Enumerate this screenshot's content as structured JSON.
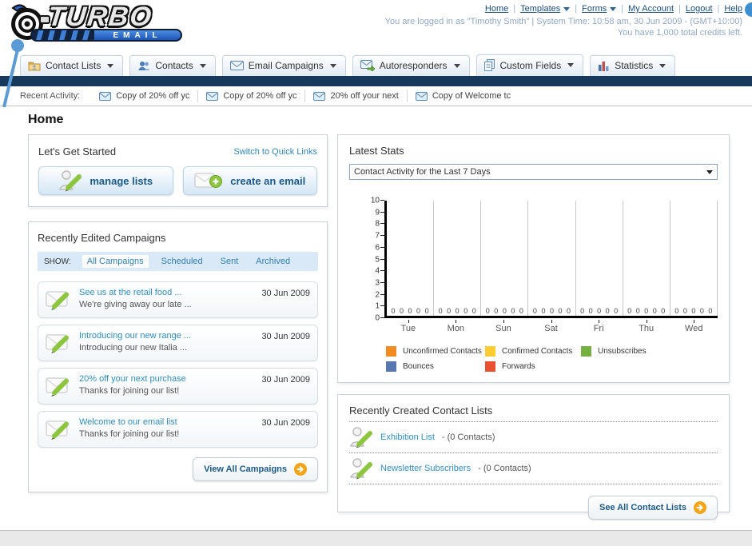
{
  "header": {
    "logo_title": "TURBO",
    "logo_subtitle": "EMAIL",
    "nav_links": [
      {
        "label": "Home",
        "dropdown": false
      },
      {
        "label": "Templates",
        "dropdown": true
      },
      {
        "label": "Forms",
        "dropdown": true
      },
      {
        "label": "My Account",
        "dropdown": false
      },
      {
        "label": "Logout",
        "dropdown": false
      },
      {
        "label": "Help",
        "dropdown": false
      }
    ],
    "login_info": "You are logged in as \"Timothy Smith\" | System Time: 10:58 am, 30 Jun 2009 - (GMT+10:00)",
    "credits_info": "You have 1,000 total credits left."
  },
  "tabs": [
    {
      "label": "Contact Lists",
      "icon": "contact-lists-icon"
    },
    {
      "label": "Contacts",
      "icon": "contacts-icon"
    },
    {
      "label": "Email Campaigns",
      "icon": "email-campaigns-icon"
    },
    {
      "label": "Autoresponders",
      "icon": "autoresponders-icon"
    },
    {
      "label": "Custom Fields",
      "icon": "custom-fields-icon"
    },
    {
      "label": "Statistics",
      "icon": "statistics-icon"
    }
  ],
  "recent_activity": {
    "label": "Recent Activity:",
    "items": [
      "Copy of 20% off yc",
      "Copy of 20% off yc",
      "20% off your next ",
      "Copy of Welcome tc"
    ]
  },
  "page_title": "Home",
  "get_started": {
    "title": "Let's Get Started",
    "switch_link": "Switch to Quick Links",
    "buttons": [
      {
        "label": "manage lists",
        "icon": "person-pencil-icon"
      },
      {
        "label": "create an email",
        "icon": "envelope-plus-icon"
      }
    ]
  },
  "campaigns": {
    "title": "Recently Edited Campaigns",
    "show_label": "SHOW:",
    "filters": [
      "All Campaigns",
      "Scheduled",
      "Sent",
      "Archived"
    ],
    "active_filter": "All Campaigns",
    "items": [
      {
        "title": "See us at the retail food ...",
        "subtitle": "We're giving away our late ...",
        "date": "30 Jun 2009"
      },
      {
        "title": "Introducing our new range ...",
        "subtitle": "Introducing our new Italia ...",
        "date": "30 Jun 2009"
      },
      {
        "title": "20% off your next purchase",
        "subtitle": "Thanks for joining our list!",
        "date": "30 Jun 2009"
      },
      {
        "title": "Welcome to our email list",
        "subtitle": "Thanks for joining our list!",
        "date": "30 Jun 2009"
      }
    ],
    "view_all_label": "View All Campaigns"
  },
  "stats": {
    "title": "Latest Stats",
    "dropdown_value": "Contact Activity for the Last 7 Days"
  },
  "chart_data": {
    "type": "bar",
    "title": "Contact Activity for the Last 7 Days",
    "categories": [
      "Tue",
      "Mon",
      "Sun",
      "Sat",
      "Fri",
      "Thu",
      "Wed"
    ],
    "series": [
      {
        "name": "Unconfirmed Contacts",
        "color": "#F28C22",
        "values": [
          0,
          0,
          0,
          0,
          0,
          0,
          0
        ]
      },
      {
        "name": "Confirmed Contacts",
        "color": "#FFCC33",
        "values": [
          0,
          0,
          0,
          0,
          0,
          0,
          0
        ]
      },
      {
        "name": "Unsubscribes",
        "color": "#76B043",
        "values": [
          0,
          0,
          0,
          0,
          0,
          0,
          0
        ]
      },
      {
        "name": "Bounces",
        "color": "#5977B3",
        "values": [
          0,
          0,
          0,
          0,
          0,
          0,
          0
        ]
      },
      {
        "name": "Forwards",
        "color": "#E9502F",
        "values": [
          0,
          0,
          0,
          0,
          0,
          0,
          0
        ]
      }
    ],
    "ylim": [
      0,
      10
    ],
    "yticks": [
      0,
      1,
      2,
      3,
      4,
      5,
      6,
      7,
      8,
      9,
      10
    ],
    "grid": true,
    "legend_position": "bottom"
  },
  "contact_lists": {
    "title": "Recently Created Contact Lists",
    "items": [
      {
        "name": "Exhibition List",
        "detail": "- (0 Contacts)"
      },
      {
        "name": "Newsletter Subscribers",
        "detail": "- (0 Contacts)"
      }
    ],
    "see_all_label": "See All Contact Lists"
  },
  "colors": {
    "navy_bar": "#16395C",
    "link_blue": "#2E8FC5",
    "button_text": "#1C5A8A",
    "accent_orange": "#F5A417"
  }
}
